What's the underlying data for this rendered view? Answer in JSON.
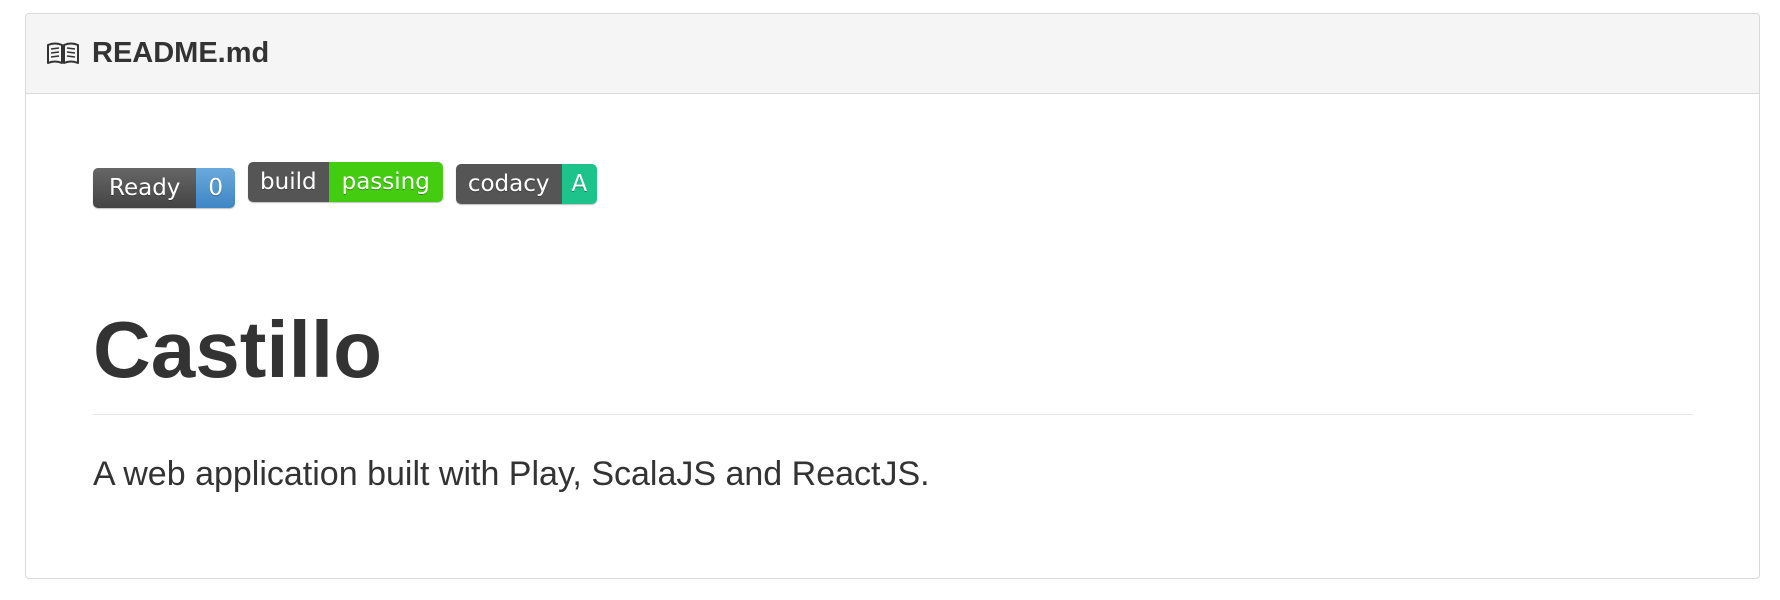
{
  "header": {
    "icon": "book-icon",
    "title": "README.md"
  },
  "badges": {
    "ready": {
      "label": "Ready",
      "value": "0",
      "color": "#3f86c4"
    },
    "build": {
      "label": "build",
      "value": "passing",
      "color": "#44cc11"
    },
    "codacy": {
      "label": "codacy",
      "value": "A",
      "color": "#1ec28b"
    }
  },
  "content": {
    "title": "Castillo",
    "description": "A web application built with Play, ScalaJS and ReactJS."
  }
}
